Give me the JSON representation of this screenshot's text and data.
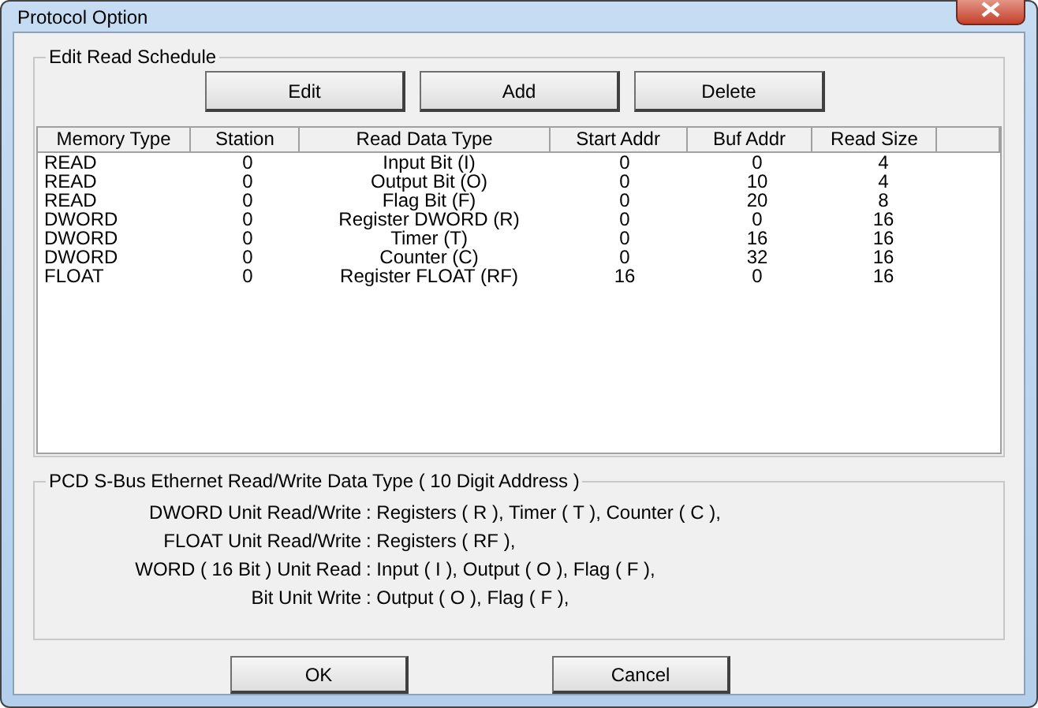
{
  "window": {
    "title": "Protocol Option"
  },
  "schedule": {
    "title": "Edit Read Schedule",
    "buttons": [
      "Edit",
      "Add",
      "Delete"
    ],
    "columns": [
      "Memory Type",
      "Station",
      "Read Data Type",
      "Start Addr",
      "Buf Addr",
      "Read Size"
    ],
    "rows": [
      [
        "READ",
        "0",
        "Input Bit (I)",
        "0",
        "0",
        "4"
      ],
      [
        "READ",
        "0",
        "Output Bit (O)",
        "0",
        "10",
        "4"
      ],
      [
        "READ",
        "0",
        "Flag Bit (F)",
        "0",
        "20",
        "8"
      ],
      [
        "DWORD",
        "0",
        "Register DWORD (R)",
        "0",
        "0",
        "16"
      ],
      [
        "DWORD",
        "0",
        "Timer (T)",
        "0",
        "16",
        "16"
      ],
      [
        "DWORD",
        "0",
        "Counter (C)",
        "0",
        "32",
        "16"
      ],
      [
        "FLOAT",
        "0",
        "Register FLOAT (RF)",
        "16",
        "0",
        "16"
      ]
    ]
  },
  "info": {
    "title": "PCD S-Bus Ethernet Read/Write Data Type ( 10 Digit Address )",
    "lines": [
      {
        "label": "DWORD Unit Read/Write",
        "value": ": Registers ( R ), Timer ( T ), Counter ( C ),"
      },
      {
        "label": "FLOAT Unit Read/Write",
        "value": ": Registers ( RF ),"
      },
      {
        "label": "WORD ( 16 Bit ) Unit Read",
        "value": ": Input ( I ), Output ( O ), Flag ( F ),"
      },
      {
        "label": "Bit Unit Write",
        "value": ": Output ( O ), Flag ( F ),"
      }
    ]
  },
  "buttons": [
    "OK",
    "Cancel"
  ]
}
